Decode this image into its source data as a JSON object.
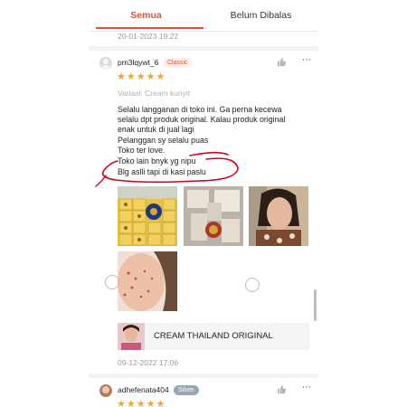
{
  "tabs": {
    "all_label": "Semua",
    "unreplied_label": "Belum Dibalas"
  },
  "prev_review": {
    "timestamp": "20-01-2023 19:22"
  },
  "review1": {
    "username": "pm3lqywt_6",
    "badge": "Classic",
    "rating": 5,
    "stars_text": "★★★★★",
    "variation": "Variasi: Cream kunyit",
    "text_lines": [
      "Selalu langganan di toko ini.  Ga perna kecewa",
      "selalu dpt produk original.  Kalau produk original",
      "enak untuk di jual lagi",
      "Pelanggan sy selalu puas",
      "Toko ter love.",
      "Toko lain bnyk yg nipu",
      "Blg aslli tapi di kasi paslu"
    ],
    "product_name": "CREAM THAILAND ORIGINAL",
    "timestamp": "09-12-2022 17:06"
  },
  "review2": {
    "username": "adhefenata404",
    "badge": "Silver",
    "stars_text": "★★★★★"
  },
  "icons": {
    "like": "thumbs-up-icon",
    "more": "more-dots-icon"
  },
  "colors": {
    "accent": "#ee4d2d",
    "star": "#f5a623",
    "annotation": "#d0021b"
  }
}
